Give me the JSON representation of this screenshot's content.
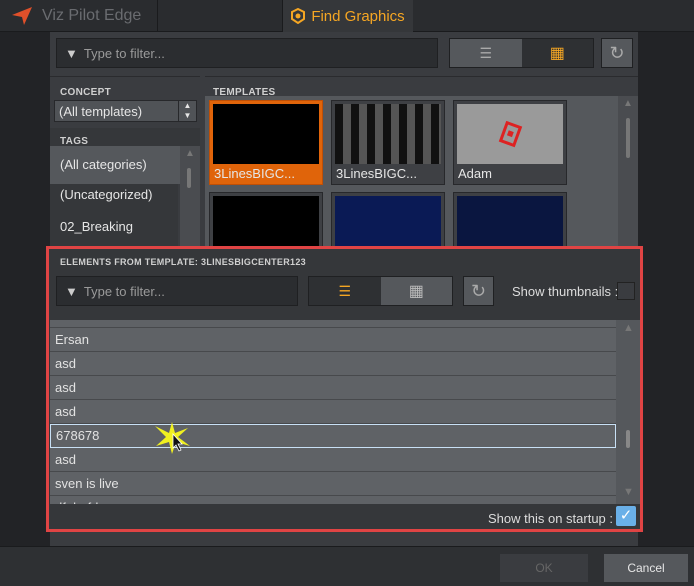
{
  "app": {
    "title": "Viz Pilot Edge",
    "active_tab": "Find Graphics"
  },
  "search": {
    "placeholder": "Type to filter..."
  },
  "concept": {
    "header": "CONCEPT",
    "selected": "(All templates)"
  },
  "tags": {
    "header": "TAGS",
    "items": [
      "(All categories)",
      "(Uncategorized)",
      "02_Breaking"
    ]
  },
  "templates": {
    "header": "TEMPLATES",
    "items": [
      {
        "label": "3LinesBIGC...",
        "selected": true
      },
      {
        "label": "3LinesBIGC..."
      },
      {
        "label": "Adam"
      },
      {
        "label": ""
      },
      {
        "label": ""
      },
      {
        "label": ""
      }
    ]
  },
  "elements": {
    "header": "ELEMENTS FROM TEMPLATE: 3LINESBIGCENTER123",
    "placeholder": "Type to filter...",
    "show_thumbnails_label": "Show thumbnails :",
    "show_thumbnails": false,
    "rows": [
      "Ersan",
      "asd",
      "asd",
      "asd",
      "678678",
      "asd",
      "sven is live",
      "dfghgfd"
    ],
    "selected_index": 4,
    "startup_label": "Show this on startup :",
    "startup_checked": true
  },
  "footer": {
    "ok": "OK",
    "cancel": "Cancel"
  },
  "colors": {
    "accent": "#f5a623",
    "selection": "#e0640a",
    "highlight_border": "#e04444",
    "checkbox": "#6ab0e8"
  }
}
